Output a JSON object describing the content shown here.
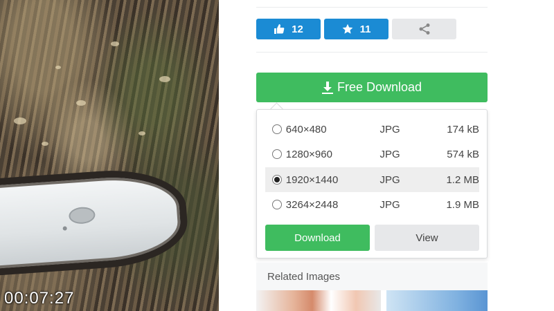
{
  "video": {
    "timestamp": "00:07:27"
  },
  "actions": {
    "like_count": "12",
    "favorite_count": "11",
    "accent_color": "#1b8bd4",
    "icons": [
      "thumbs-up-icon",
      "star-icon",
      "share-icon"
    ]
  },
  "free_download": {
    "label": "Free Download",
    "color": "#3fbc5f"
  },
  "download_options": [
    {
      "resolution": "640×480",
      "format": "JPG",
      "size": "174 kB",
      "selected": false
    },
    {
      "resolution": "1280×960",
      "format": "JPG",
      "size": "574 kB",
      "selected": false
    },
    {
      "resolution": "1920×1440",
      "format": "JPG",
      "size": "1.2 MB",
      "selected": true
    },
    {
      "resolution": "3264×2448",
      "format": "JPG",
      "size": "1.9 MB",
      "selected": false
    }
  ],
  "dropdown_buttons": {
    "download_label": "Download",
    "view_label": "View"
  },
  "related": {
    "label": "Related Images"
  }
}
